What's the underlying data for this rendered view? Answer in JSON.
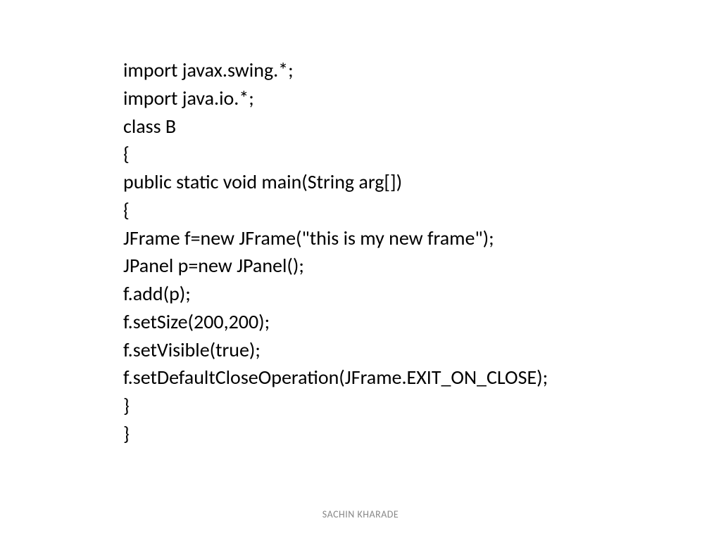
{
  "code": {
    "line1": "import javax.swing.*;",
    "line2": "import java.io.*;",
    "line3": "class B",
    "line4": "{",
    "line5": "public static void main(String arg[])",
    "line6": "{",
    "line7": "JFrame f=new JFrame(\"this is my new frame\");",
    "line8": "JPanel p=new JPanel();",
    "line9": "f.add(p);",
    "line10": "f.setSize(200,200);",
    "line11": "f.setVisible(true);",
    "line12": "f.setDefaultCloseOperation(JFrame.EXIT_ON_CLOSE);",
    "line13": "}",
    "line14": "}"
  },
  "footer": "SACHIN KHARADE"
}
